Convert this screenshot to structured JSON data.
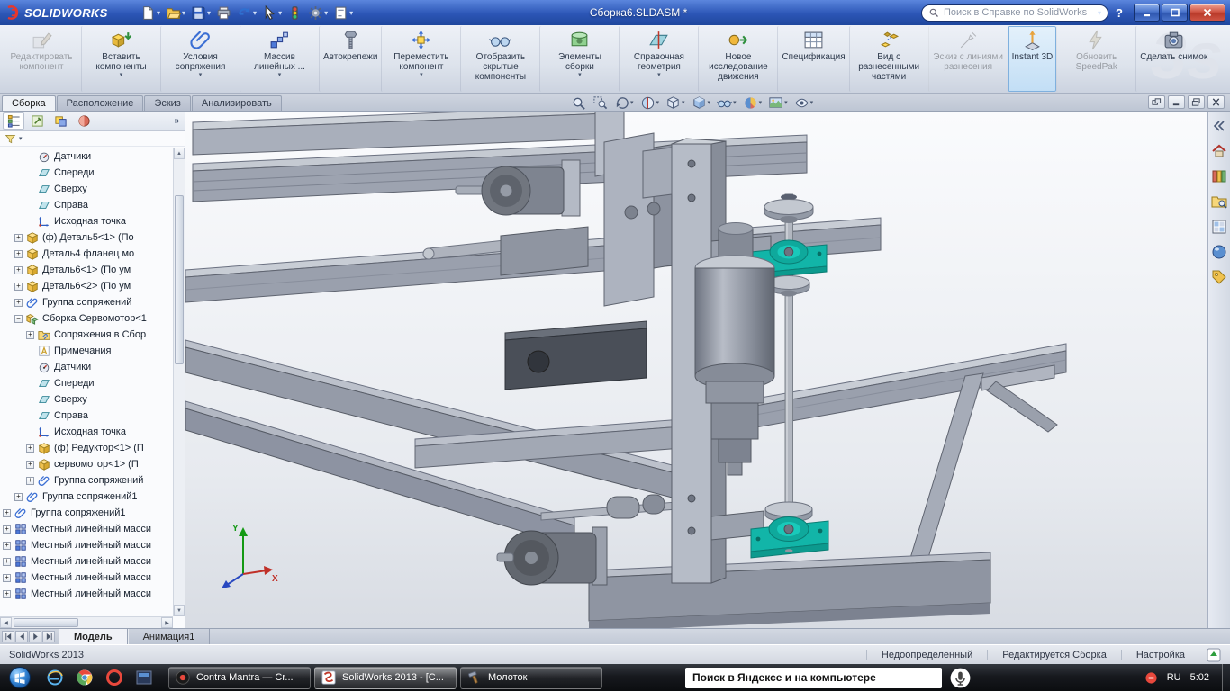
{
  "titlebar": {
    "brand": "SOLIDWORKS",
    "title": "Сборка6.SLDASM *",
    "search_placeholder": "Поиск в Справке по SolidWorks",
    "help_glyph": "?",
    "toolbar": [
      {
        "icon": "new-document",
        "arrow": true
      },
      {
        "icon": "open",
        "arrow": true
      },
      {
        "icon": "save",
        "arrow": true
      },
      {
        "icon": "print",
        "arrow": false
      },
      {
        "icon": "undo",
        "arrow": true
      },
      {
        "icon": "select",
        "arrow": true
      },
      {
        "icon": "rebuild",
        "arrow": false
      },
      {
        "icon": "options",
        "arrow": true
      },
      {
        "icon": "file-properties",
        "arrow": true
      }
    ],
    "window_buttons": [
      {
        "icon": "minimize-window"
      },
      {
        "icon": "maximize-window"
      },
      {
        "icon": "close-window"
      }
    ]
  },
  "ribbon": {
    "watermark": "3s",
    "buttons": [
      {
        "icon": "edit-component",
        "label": "Редактировать компонент",
        "disabled": true
      },
      {
        "icon": "insert-components",
        "label": "Вставить компоненты",
        "arrow": true
      },
      {
        "icon": "mate",
        "label": "Условия сопряжения",
        "arrow": true
      },
      {
        "icon": "linear-pattern",
        "label": "Массив линейных ...",
        "arrow": true
      },
      {
        "icon": "smart-fasteners",
        "label": "Автокрепежи"
      },
      {
        "icon": "move-component",
        "label": "Переместить компонент",
        "arrow": true
      },
      {
        "icon": "show-hidden",
        "label": "Отобразить скрытые компоненты"
      },
      {
        "icon": "assembly-features",
        "label": "Элементы сборки",
        "arrow": true
      },
      {
        "icon": "reference-geometry",
        "label": "Справочная геометрия",
        "arrow": true
      },
      {
        "icon": "motion-study",
        "label": "Новое исследование движения"
      },
      {
        "icon": "bom",
        "label": "Спецификация"
      },
      {
        "icon": "exploded-view",
        "label": "Вид с разнесенными частями"
      },
      {
        "icon": "explode-sketch",
        "label": "Эскиз с линиями разнесения",
        "disabled": true
      },
      {
        "icon": "instant3d",
        "label": "Instant 3D",
        "active": true
      },
      {
        "icon": "speedpak",
        "label": "Обновить SpeedPak",
        "disabled": true
      },
      {
        "icon": "snapshot",
        "label": "Сделать снимок"
      }
    ],
    "tabs": [
      {
        "label": "Сборка",
        "active": true
      },
      {
        "label": "Расположение"
      },
      {
        "label": "Эскиз"
      },
      {
        "label": "Анализировать"
      }
    ]
  },
  "headsup": [
    {
      "icon": "zoom-fit"
    },
    {
      "icon": "zoom-area"
    },
    {
      "icon": "previous-view",
      "arrow": true
    },
    {
      "icon": "section-view",
      "arrow": true
    },
    {
      "icon": "view-orientation",
      "arrow": true
    },
    {
      "icon": "display-style",
      "arrow": true
    },
    {
      "icon": "hide-show",
      "arrow": true
    },
    {
      "icon": "edit-appearance",
      "arrow": true
    },
    {
      "icon": "apply-scene",
      "arrow": true
    },
    {
      "icon": "view-settings",
      "arrow": true
    }
  ],
  "doc_window_controls": [
    {
      "icon": "restore-group"
    },
    {
      "icon": "minimize-doc"
    },
    {
      "icon": "restore-doc"
    },
    {
      "icon": "close-doc"
    }
  ],
  "feature_tree": {
    "panel_tabs": [
      "featuremanager",
      "propertymanager",
      "configurationmanager",
      "dimxpertmanager"
    ],
    "items": [
      {
        "label": "Датчики",
        "icon": "sensors",
        "indent": 2
      },
      {
        "label": "Спереди",
        "icon": "plane",
        "indent": 2
      },
      {
        "label": "Сверху",
        "icon": "plane",
        "indent": 2
      },
      {
        "label": "Справа",
        "icon": "plane",
        "indent": 2
      },
      {
        "label": "Исходная точка",
        "icon": "origin",
        "indent": 2
      },
      {
        "label": "(ф) Деталь5<1> (По",
        "icon": "part",
        "indent": 1,
        "expand": "plus"
      },
      {
        "label": "Деталь4 фланец мо",
        "icon": "part",
        "indent": 1,
        "expand": "plus"
      },
      {
        "label": "Деталь6<1> (По ум",
        "icon": "part",
        "indent": 1,
        "expand": "plus"
      },
      {
        "label": "Деталь6<2> (По ум",
        "icon": "part",
        "indent": 1,
        "expand": "plus"
      },
      {
        "label": "Группа сопряжений",
        "icon": "mates",
        "indent": 1,
        "expand": "plus"
      },
      {
        "label": "Сборка Сервомотор<1",
        "icon": "assembly",
        "indent": 1,
        "expand": "minus"
      },
      {
        "label": "Сопряжения в Сбор",
        "icon": "mates-folder",
        "indent": 2,
        "expand": "plus"
      },
      {
        "label": "Примечания",
        "icon": "annotations",
        "indent": 2
      },
      {
        "label": "Датчики",
        "icon": "sensors",
        "indent": 2
      },
      {
        "label": "Спереди",
        "icon": "plane",
        "indent": 2
      },
      {
        "label": "Сверху",
        "icon": "plane",
        "indent": 2
      },
      {
        "label": "Справа",
        "icon": "plane",
        "indent": 2
      },
      {
        "label": "Исходная точка",
        "icon": "origin",
        "indent": 2
      },
      {
        "label": "(ф) Редуктор<1> (П",
        "icon": "part",
        "indent": 2,
        "expand": "plus"
      },
      {
        "label": "сервомотор<1> (П",
        "icon": "part",
        "indent": 2,
        "expand": "plus"
      },
      {
        "label": "Группа сопряжений",
        "icon": "mates",
        "indent": 2,
        "expand": "plus"
      },
      {
        "label": "Группа сопряжений1",
        "icon": "mates",
        "indent": 1,
        "expand": "plus"
      },
      {
        "label": "Группа сопряжений1",
        "icon": "mates",
        "indent": 0,
        "expand": "plus"
      },
      {
        "label": "Местный линейный масси",
        "icon": "pattern",
        "indent": 0,
        "expand": "plus"
      },
      {
        "label": "Местный линейный масси",
        "icon": "pattern",
        "indent": 0,
        "expand": "plus"
      },
      {
        "label": "Местный линейный масси",
        "icon": "pattern",
        "indent": 0,
        "expand": "plus"
      },
      {
        "label": "Местный линейный масси",
        "icon": "pattern",
        "indent": 0,
        "expand": "plus"
      },
      {
        "label": "Местный линейный масси",
        "icon": "pattern",
        "indent": 0,
        "expand": "plus"
      }
    ]
  },
  "viewport": {
    "triad": {
      "x_label": "X",
      "y_label": "Y"
    }
  },
  "task_pane": [
    {
      "icon": "collapse-chevrons"
    },
    {
      "icon": "solidworks-resources"
    },
    {
      "icon": "design-library"
    },
    {
      "icon": "file-explorer"
    },
    {
      "icon": "view-palette"
    },
    {
      "icon": "appearances"
    },
    {
      "icon": "custom-properties"
    }
  ],
  "doc_tabs": {
    "nav": [
      "first",
      "prev",
      "next",
      "last"
    ],
    "tabs": [
      {
        "label": "Модель",
        "active": true
      },
      {
        "label": "Анимация1"
      }
    ]
  },
  "statusbar": {
    "left": "SolidWorks 2013",
    "items": [
      "Недоопределенный",
      "Редактируется Сборка",
      "Настройка"
    ]
  },
  "taskbar": {
    "quick_launch": [
      {
        "icon": "internet-explorer"
      },
      {
        "icon": "chrome"
      },
      {
        "icon": "opera"
      },
      {
        "icon": "app-window"
      }
    ],
    "windows": [
      {
        "icon": "media-tab",
        "label": "Contra Mantra — Cr..."
      },
      {
        "icon": "solidworks-app",
        "label": "SolidWorks 2013 - [C...",
        "active": true
      },
      {
        "icon": "hammer",
        "label": "Молоток"
      }
    ],
    "search_value": "Поиск в Яндексе и на компьютере",
    "lang": "RU",
    "time": "5:02"
  }
}
